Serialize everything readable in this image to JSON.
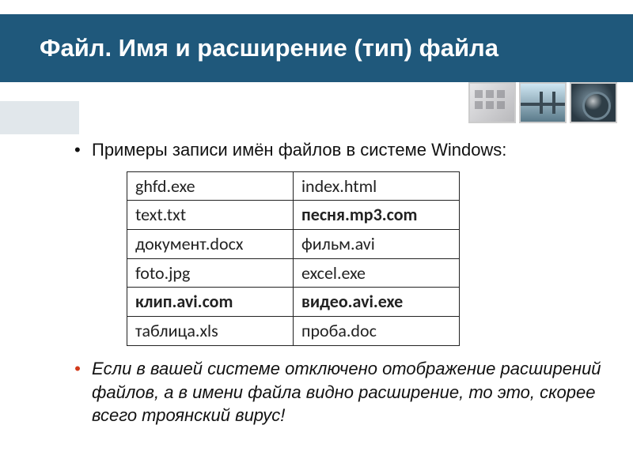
{
  "title": "Файл. Имя и расширение (тип) файла",
  "intro": "Примеры записи имён файлов в системе Windows:",
  "table": {
    "rows": [
      {
        "c0": {
          "text": "ghfd.exe",
          "bold": false
        },
        "c1": {
          "text": "index.html",
          "bold": false
        }
      },
      {
        "c0": {
          "text": "text.txt",
          "bold": false
        },
        "c1": {
          "text": "песня.mp3.com",
          "bold": true
        }
      },
      {
        "c0": {
          "text": "документ.docx",
          "bold": false
        },
        "c1": {
          "text": "фильм.avi",
          "bold": false
        }
      },
      {
        "c0": {
          "text": "foto.jpg",
          "bold": false
        },
        "c1": {
          "text": "excel.exe",
          "bold": false
        }
      },
      {
        "c0": {
          "text": "клип.avi.com",
          "bold": true
        },
        "c1": {
          "text": "видео.avi.exe",
          "bold": true
        }
      },
      {
        "c0": {
          "text": "таблица.xls",
          "bold": false
        },
        "c1": {
          "text": "проба.doc",
          "bold": false
        }
      }
    ]
  },
  "warning": "Если в вашей системе отключено отображение расширений файлов, а в имени файла видно расширение, то это, скорее всего троянский вирус!"
}
